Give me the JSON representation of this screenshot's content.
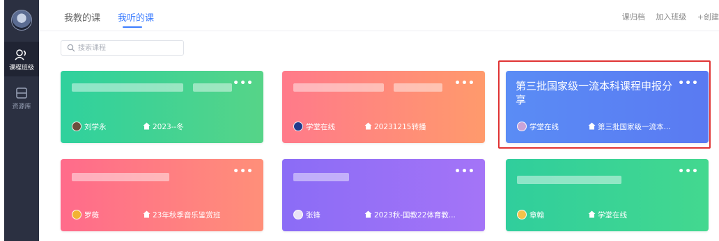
{
  "sidebar": {
    "items": [
      {
        "label": "课程班级",
        "icon": "course-class-icon"
      },
      {
        "label": "资源库",
        "icon": "library-icon"
      }
    ]
  },
  "topbar": {
    "tabs": [
      {
        "label": "我教的课"
      },
      {
        "label": "我听的课"
      }
    ],
    "actions": {
      "archive": "课归档",
      "join_class": "加入班级",
      "create": "+创建"
    }
  },
  "search": {
    "placeholder": "搜索课程"
  },
  "cards": [
    {
      "title": "",
      "owner": "刘学永",
      "class": "2023--冬",
      "more": "•••"
    },
    {
      "title": "",
      "owner": "学堂在线",
      "class": "20231215转播",
      "more": "•••"
    },
    {
      "title": "第三批国家级一流本科课程申报分享",
      "owner": "学堂在线",
      "class": "第三批国家级一流本...",
      "more": "•••"
    },
    {
      "title": "",
      "owner": "罗薇",
      "class": "23年秋季音乐鉴赏班",
      "more": "•••"
    },
    {
      "title": "",
      "owner": "张锋",
      "class": "2023秋-国教22体育教...",
      "more": "•••"
    },
    {
      "title": "",
      "owner": "章翰",
      "class": "学堂在线",
      "more": "•••"
    }
  ],
  "colors": {
    "accent": "#3b7cff",
    "sidebar": "#2b3041",
    "highlight": "#e03333"
  }
}
